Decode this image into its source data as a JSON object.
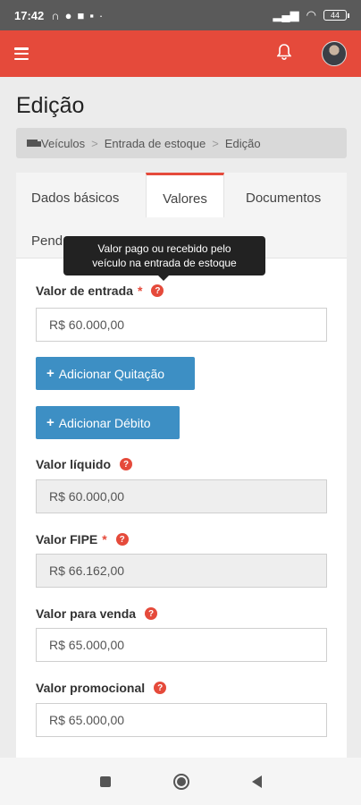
{
  "status_bar": {
    "time": "17:42",
    "battery": "44"
  },
  "header": {
    "menu_icon": "hamburger-icon",
    "notification_icon": "bell-icon",
    "brand_color": "#e54a3b"
  },
  "page": {
    "title": "Edição"
  },
  "breadcrumb": {
    "items": [
      "Veículos",
      "Entrada de estoque",
      "Edição"
    ],
    "separator": ">"
  },
  "tabs": {
    "items": [
      "Dados básicos",
      "Valores",
      "Documentos",
      "Pend"
    ],
    "active": "Valores"
  },
  "tooltip": {
    "line1": "Valor pago ou recebido pelo",
    "line2": "veículo na entrada de estoque"
  },
  "form": {
    "valor_entrada": {
      "label": "Valor de entrada",
      "required": "*",
      "value": "R$ 60.000,00"
    },
    "btn_quitacao": "Adicionar Quitação",
    "btn_debito": "Adicionar Débito",
    "valor_liquido": {
      "label": "Valor líquido",
      "value": "R$ 60.000,00"
    },
    "valor_fipe": {
      "label": "Valor FIPE",
      "required": "*",
      "value": "R$ 66.162,00"
    },
    "valor_venda": {
      "label": "Valor para venda",
      "value": "R$ 65.000,00"
    },
    "valor_promocional": {
      "label": "Valor promocional",
      "value": "R$ 65.000,00"
    },
    "help_symbol": "?",
    "plus_symbol": "+"
  }
}
